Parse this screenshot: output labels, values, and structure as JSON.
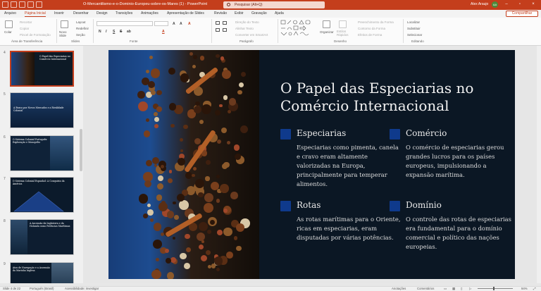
{
  "window": {
    "title": "O-Mercantilismo-e-o-Dominio-Europeu-sobre-os-Mares (1) - PowerPoint",
    "search_placeholder": "Pesquisar (Alt+Q)",
    "user": "Alex Araujo",
    "user_initials": "AA",
    "accent": "#c43e1c"
  },
  "tabs": [
    "Arquivo",
    "Página Inicial",
    "Inserir",
    "Desenhar",
    "Design",
    "Transições",
    "Animações",
    "Apresentação de Slides",
    "Revisão",
    "Exibir",
    "Gravação",
    "Ajuda"
  ],
  "share": "Compartilhar",
  "ribbon": {
    "clipboard": {
      "paste": "Colar",
      "cut": "Recortar",
      "copy": "Copiar",
      "format_painter": "Pincel de Formatação",
      "group": "Área de Transferência"
    },
    "slides": {
      "new_slide": "Novo Slide",
      "layout": "Layout",
      "reset": "Redefinir",
      "section": "Seção",
      "group": "Slides"
    },
    "font": {
      "group": "Fonte",
      "bold": "N",
      "italic": "I",
      "underline": "S",
      "strike": "S",
      "shadow": "ab"
    },
    "paragraph": {
      "direction": "Direção do Texto",
      "align": "Alinhar Texto",
      "smartart": "Converter em SmartArt",
      "group": "Parágrafo"
    },
    "drawing": {
      "arrange": "Organizar",
      "quick_styles": "Estilos Rápidos",
      "fill": "Preenchimento da Forma",
      "outline": "Contorno da Forma",
      "effects": "Efeitos de Forma",
      "group": "Desenho"
    },
    "editing": {
      "find": "Localizar",
      "replace": "Substituir",
      "select": "Selecionar",
      "group": "Editando"
    }
  },
  "thumbnails": [
    {
      "num": "4",
      "title": "O Papel das Especiarias no Comércio Internacional",
      "selected": true
    },
    {
      "num": "5",
      "title": "A Busca por Novos Mercados e a Rivalidade Colonial",
      "selected": false
    },
    {
      "num": "6",
      "title": "O Sistema Colonial Português: Exploração e Monopólio",
      "selected": false
    },
    {
      "num": "7",
      "title": "O Sistema Colonial Espanhol: A Conquista da América",
      "selected": false
    },
    {
      "num": "8",
      "title": "A Ascensão da Inglaterra e da Holanda como Potências Marítimas",
      "selected": false
    },
    {
      "num": "9",
      "title": "Atos de Navegação e a Ascensão da Marinha Inglesa",
      "selected": false
    }
  ],
  "slide": {
    "title": "O Papel das Especiarias no Comércio Internacional",
    "points": [
      {
        "heading": "Especiarias",
        "body": "Especiarias como pimenta, canela e cravo eram altamente valorizadas na Europa, principalmente para temperar alimentos."
      },
      {
        "heading": "Comércio",
        "body": "O comércio de especiarias gerou grandes lucros para os países europeus, impulsionando a expansão marítima."
      },
      {
        "heading": "Rotas",
        "body": "As rotas marítimas para o Oriente, ricas em especiarias, eram disputadas por várias potências."
      },
      {
        "heading": "Domínio",
        "body": "O controle das rotas de especiarias era fundamental para o domínio comercial e político das nações europeias."
      }
    ]
  },
  "status": {
    "slide": "Slide 4 de 22",
    "language": "Português (Brasil)",
    "accessibility": "Acessibilidade: investigar",
    "notes": "Anotações",
    "comments": "Comentários",
    "zoom": "94%"
  }
}
